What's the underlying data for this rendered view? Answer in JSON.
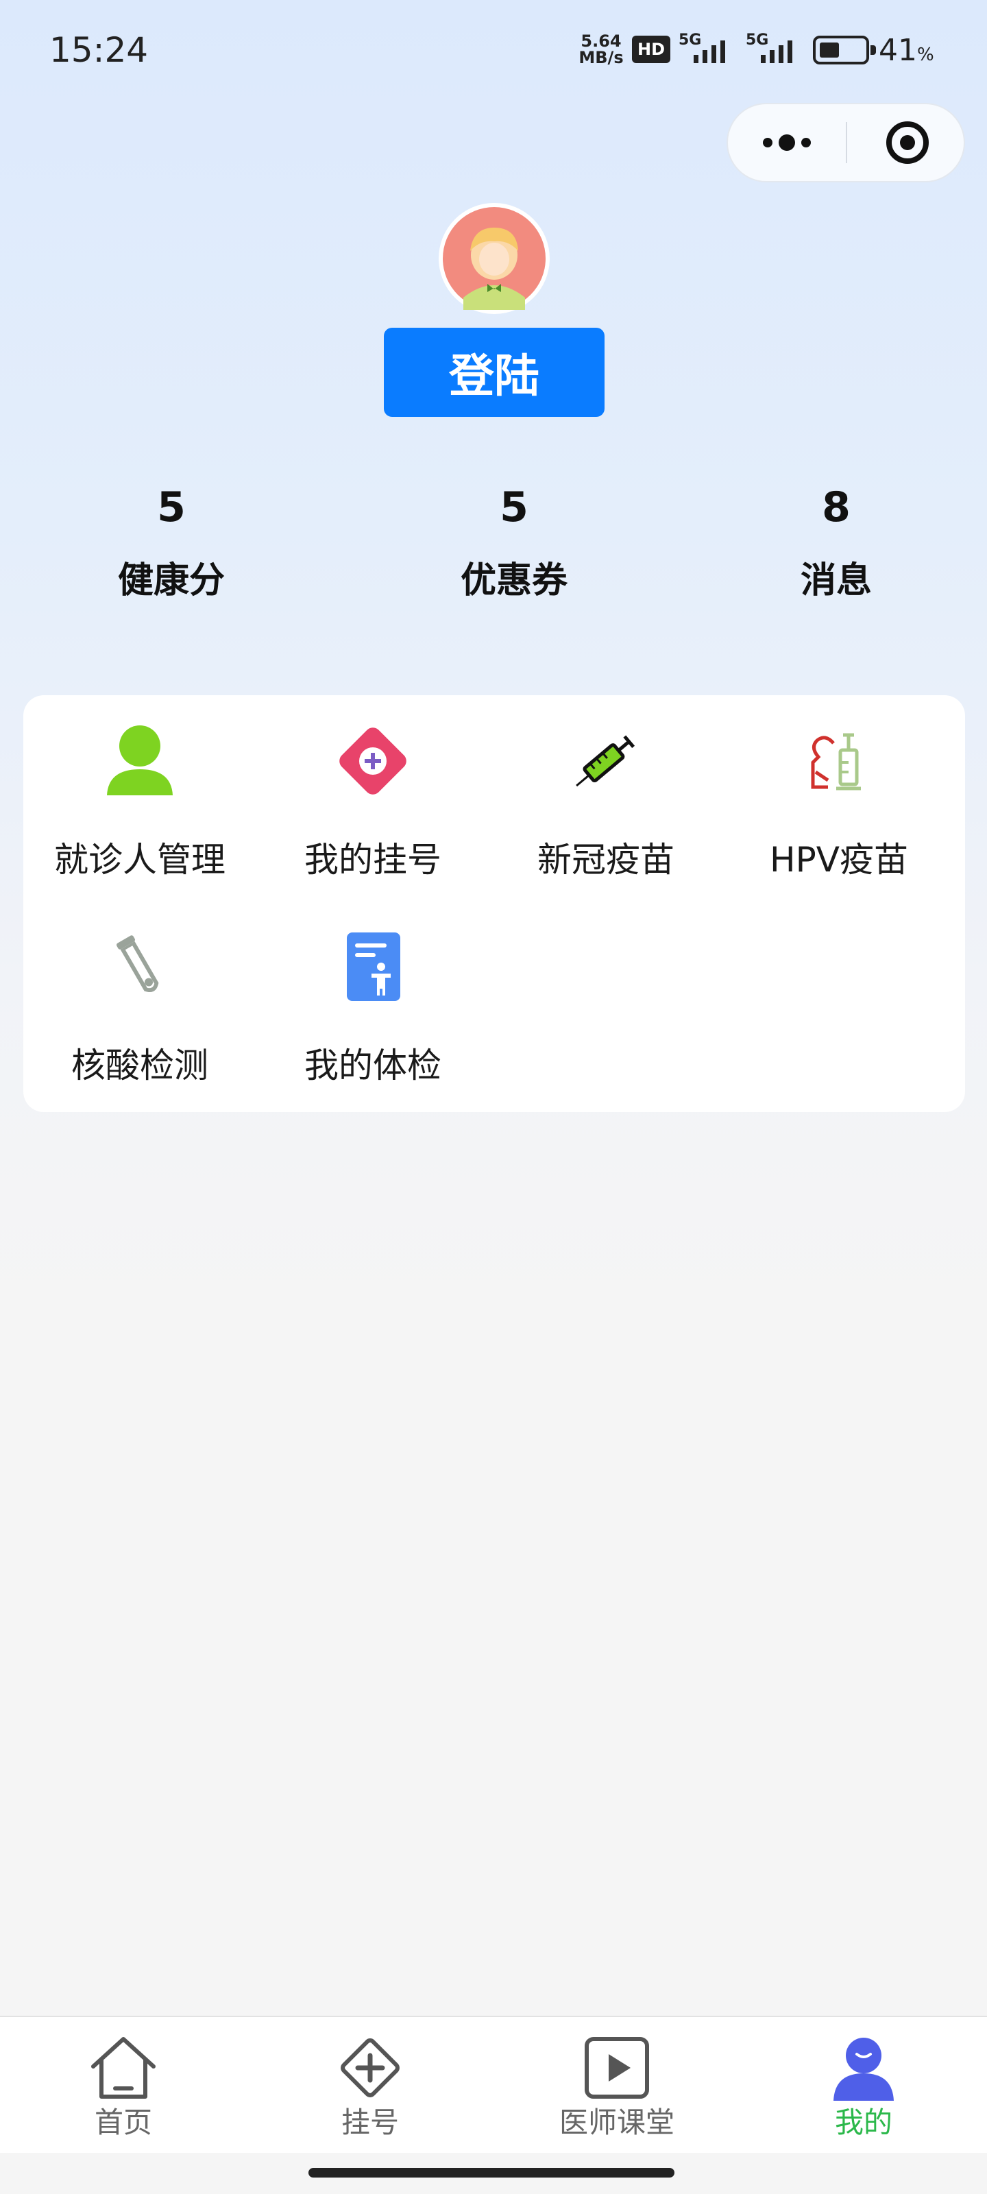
{
  "status_bar": {
    "time": "15:24",
    "net_speed_value": "5.64",
    "net_speed_unit": "MB/s",
    "hd_label": "HD",
    "signal_1_label": "5G",
    "signal_2_label": "5G",
    "battery_percent": "41",
    "battery_percent_unit": "%",
    "battery_level": 0.41
  },
  "profile": {
    "login_label": "登陆"
  },
  "stats": [
    {
      "value": "5",
      "label": "健康分"
    },
    {
      "value": "5",
      "label": "优惠券"
    },
    {
      "value": "8",
      "label": "消息"
    }
  ],
  "menu": {
    "items": [
      {
        "label": "就诊人管理",
        "icon": "person-icon",
        "color": "#7ed321"
      },
      {
        "label": "我的挂号",
        "icon": "registration-icon",
        "color": "#e8436a"
      },
      {
        "label": "新冠疫苗",
        "icon": "syringe-icon",
        "color": "#222222"
      },
      {
        "label": "HPV疫苗",
        "icon": "vaccine-icon",
        "color": "#d0312d"
      },
      {
        "label": "核酸检测",
        "icon": "test-tube-icon",
        "color": "#9aa39a"
      },
      {
        "label": "我的体检",
        "icon": "checkup-report-icon",
        "color": "#4b8cf5"
      }
    ]
  },
  "tab_bar": {
    "tabs": [
      {
        "label": "首页",
        "icon": "home-icon",
        "active": false
      },
      {
        "label": "挂号",
        "icon": "plus-diamond-icon",
        "active": false
      },
      {
        "label": "医师课堂",
        "icon": "play-icon",
        "active": false
      },
      {
        "label": "我的",
        "icon": "user-icon",
        "active": true
      }
    ],
    "active_color": "#2bb84a",
    "inactive_color": "#666666"
  },
  "colors": {
    "primary_button": "#0a7cff",
    "user_tab_icon": "#4f5fe8"
  }
}
